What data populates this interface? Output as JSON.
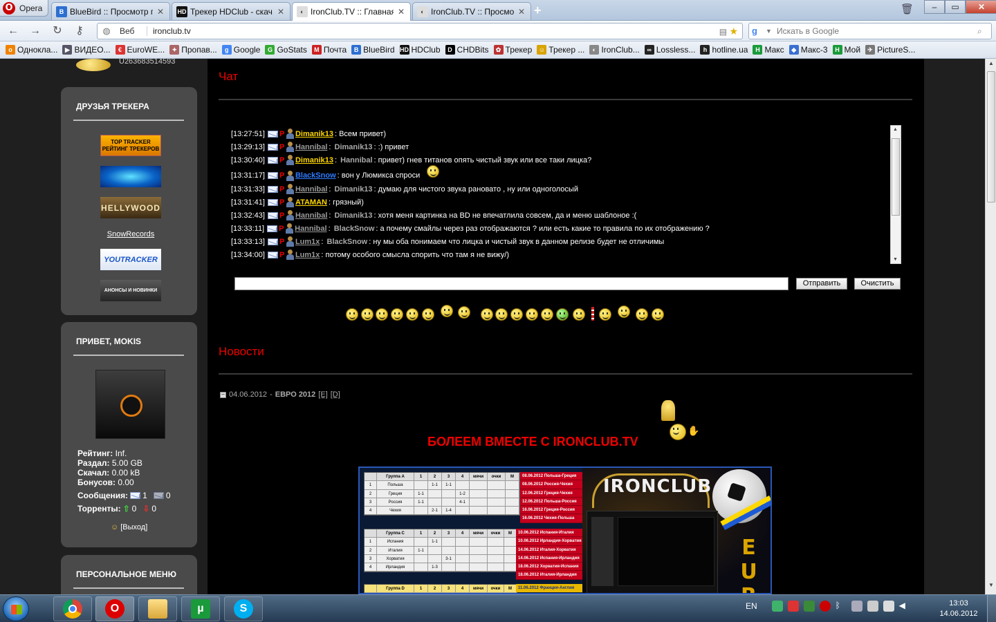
{
  "browser": {
    "menu_label": "Opera",
    "tabs": [
      {
        "title": "BlueBird :: Просмотр п...",
        "active": false
      },
      {
        "title": "Трекер HDClub - скач...",
        "active": false
      },
      {
        "title": "IronClub.TV :: Главная",
        "active": true
      },
      {
        "title": "IronClub.TV :: Просмо...",
        "active": false
      }
    ],
    "address_mode": "Веб",
    "url": "ironclub.tv",
    "search_placeholder": "Искать в Google",
    "bookmarks": [
      "Однокла...",
      "ВИДЕО...",
      "EuroWE...",
      "Пропав...",
      "Google",
      "GoStats",
      "Почта",
      "BlueBird",
      "HDClub",
      "CHDBits",
      "Трекер",
      "Трекер ...",
      "IronClub...",
      "Lossless...",
      "hotline.ua",
      "Макс",
      "Макс-3",
      "Мой",
      "PictureS..."
    ]
  },
  "sidebar": {
    "user_id": "U263683514593",
    "friends_title": "ДРУЗЬЯ ТРЕКЕРА",
    "friends_banners": [
      "TOP TRACKER\nРЕЙТИНГ ТРЕКЕРОВ",
      "",
      "HELLYWOOD",
      "SnowRecords",
      "YOUTRACKER",
      "АНОНСЫ И НОВИНКИ"
    ],
    "greeting_title": "ПРИВЕТ, MOKIS",
    "stats": {
      "rating_label": "Рейтинг:",
      "rating_value": "Inf.",
      "uploaded_label": "Раздал:",
      "uploaded_value": "5.00 GB",
      "downloaded_label": "Скачал:",
      "downloaded_value": "0.00 kB",
      "bonus_label": "Бонусов:",
      "bonus_value": "0.00",
      "messages_label": "Сообщения:",
      "messages_new": "1",
      "messages_old": "0",
      "torrents_label": "Торренты:",
      "torrents_up": "0",
      "torrents_down": "0"
    },
    "logout_label": "[Выход]",
    "personal_menu_title": "ПЕРСОНАЛЬНОЕ МЕНЮ"
  },
  "chat": {
    "title": "Чат",
    "messages": [
      {
        "time": "[13:27:51]",
        "nick": "Dimanik13",
        "nick_color": "#ffd700",
        "target": "",
        "text": ": Всем привет)"
      },
      {
        "time": "[13:29:13]",
        "nick": "Hannibal",
        "nick_color": "#9a9a9a",
        "target": "Dimanik13",
        "text": ": :) привет"
      },
      {
        "time": "[13:30:40]",
        "nick": "Dimanik13",
        "nick_color": "#ffd700",
        "target": "Hannibal",
        "text": ": привет) гнев титанов опять чистый звук или все таки лицка?"
      },
      {
        "time": "[13:31:17]",
        "nick": "BlackSnow",
        "nick_color": "#2f7bff",
        "target": "",
        "text": ": вон у Люмикса спроси"
      },
      {
        "time": "[13:31:33]",
        "nick": "Hannibal",
        "nick_color": "#9a9a9a",
        "target": "Dimanik13",
        "text": ": думаю для чистого звука рановато , ну или одноголосый"
      },
      {
        "time": "[13:31:41]",
        "nick": "ATAMAN",
        "nick_color": "#ffd700",
        "target": "",
        "text": ": грязный)"
      },
      {
        "time": "[13:32:43]",
        "nick": "Hannibal",
        "nick_color": "#9a9a9a",
        "target": "Dimanik13",
        "text": ": хотя меня картинка на BD не впечатлила совсем, да и меню шаблоное :("
      },
      {
        "time": "[13:33:11]",
        "nick": "Hannibal",
        "nick_color": "#9a9a9a",
        "target": "BlackSnow",
        "text": ": а почему смайлы через раз отображаются ? или есть какие то правила по их отображению ?"
      },
      {
        "time": "[13:33:13]",
        "nick": "Lum1x",
        "nick_color": "#9a9a9a",
        "target": "BlackSnow",
        "text": ": ну мы оба понимаем что лицка и чистый звук в данном релизе будет не отличимы"
      },
      {
        "time": "[13:34:00]",
        "nick": "Lum1x",
        "nick_color": "#9a9a9a",
        "target": "",
        "text": ": потому особого смысла спорить что там я не вижу/)"
      }
    ],
    "send_label": "Отправить",
    "clear_label": "Очистить",
    "input_value": ""
  },
  "news": {
    "title": "Новости",
    "item_date": "04.06.2012",
    "item_sep": " - ",
    "item_title": "ЕВРО 2012",
    "edit_label": "[E]",
    "delete_label": "[D]",
    "headline": "БОЛЕЕМ ВМЕСТЕ С IRONCLUB.TV",
    "image": {
      "logo_text": "IRONCLUB",
      "side_text": "EUR",
      "group_a": {
        "header": [
          "",
          "Группа A",
          "1",
          "2",
          "3",
          "4",
          "мячи",
          "очки",
          "М"
        ],
        "rows": [
          [
            "1",
            "Польша",
            "",
            "1-1",
            "1-1",
            "",
            "",
            "",
            ""
          ],
          [
            "2",
            "Греция",
            "1-1",
            "",
            "",
            "1-2",
            "",
            "",
            ""
          ],
          [
            "3",
            "Россия",
            "1-1",
            "",
            "",
            "4-1",
            "",
            "",
            ""
          ],
          [
            "4",
            "Чехия",
            "",
            "2-1",
            "1-4",
            "",
            "",
            "",
            ""
          ]
        ],
        "results": [
          "08.06.2012  Польша-Греция",
          "08.06.2012  Россия-Чехия",
          "12.06.2012  Греция-Чехия",
          "12.06.2012  Польша-Россия",
          "16.06.2012  Греция-Россия",
          "16.06.2012  Чехия-Польша"
        ]
      },
      "group_c": {
        "header": [
          "",
          "Группа C",
          "1",
          "2",
          "3",
          "4",
          "мячи",
          "очки",
          "М"
        ],
        "rows": [
          [
            "1",
            "Испания",
            "",
            "1-1",
            "",
            "",
            "",
            "",
            ""
          ],
          [
            "2",
            "Италия",
            "1-1",
            "",
            "",
            "",
            "",
            "",
            ""
          ],
          [
            "3",
            "Хорватия",
            "",
            "",
            "3-1",
            "",
            "",
            "",
            ""
          ],
          [
            "4",
            "Ирландия",
            "",
            "1-3",
            "",
            "",
            "",
            "",
            ""
          ]
        ],
        "results": [
          "10.06.2012  Испания-Италия",
          "10.06.2012  Ирландия-Хорватия",
          "14.06.2012  Италия-Хорватия",
          "14.06.2012  Испания-Ирландия",
          "18.06.2012  Хорватия-Испания",
          "18.06.2012  Италия-Ирландия"
        ]
      },
      "group_d": {
        "header": [
          "",
          "Группа D",
          "1",
          "2",
          "3",
          "4",
          "мячи",
          "очки",
          "М"
        ],
        "results": [
          "11.06.2012  Франция-Англия"
        ]
      }
    }
  },
  "taskbar": {
    "language": "EN",
    "time": "13:03",
    "date": "14.06.2012"
  }
}
